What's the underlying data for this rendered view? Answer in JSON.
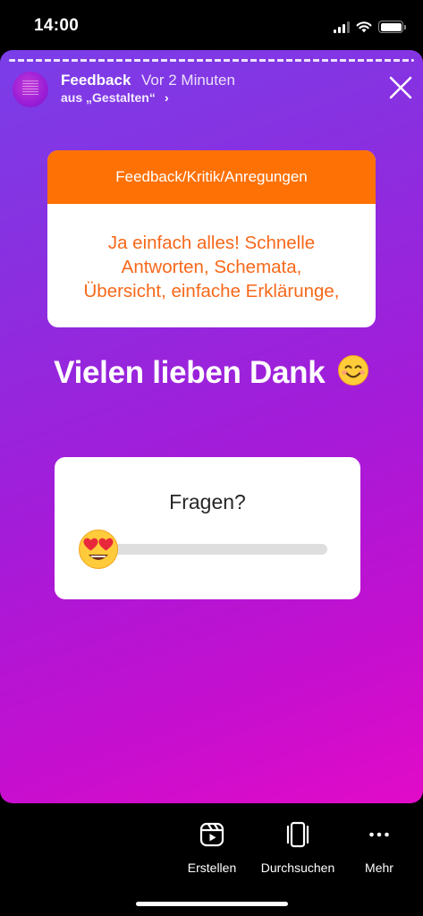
{
  "status_bar": {
    "time": "14:00"
  },
  "story": {
    "header": {
      "title": "Feedback",
      "time_ago": "Vor 2 Minuten",
      "source": "aus „Gestalten“",
      "chevron": "›"
    },
    "question_sticker": {
      "label": "Feedback/Kritik/Anregungen",
      "answer_lines": [
        "Ja einfach alles! Schnelle",
        "Antworten, Schemata,",
        "Übersicht, einfache Erklärunge,"
      ]
    },
    "caption": "Vielen lieben Dank",
    "slider_sticker": {
      "question": "Fragen?",
      "emoji": "heart-eyes-emoji",
      "value_fraction": 0.05
    },
    "colors": {
      "gradient_start": "#7a3ee8",
      "gradient_end": "#e10bc7",
      "question_header": "#fe7105",
      "question_text": "#f7681a"
    }
  },
  "bottom_bar": {
    "actions": [
      {
        "label": "Erstellen",
        "icon": "reels-icon"
      },
      {
        "label": "Durchsuchen",
        "icon": "browse-icon"
      },
      {
        "label": "Mehr",
        "icon": "more-icon"
      }
    ]
  }
}
